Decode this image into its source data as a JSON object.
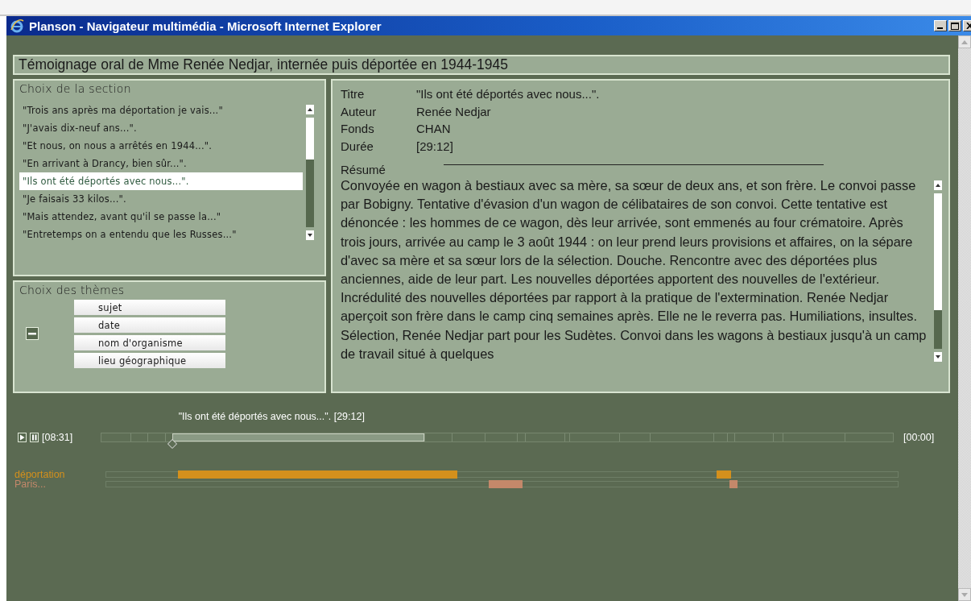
{
  "window": {
    "title": "Planson - Navigateur multimédia - Microsoft Internet Explorer"
  },
  "heading": "Témoignage oral de Mme Renée Nedjar, internée puis déportée en 1944-1945",
  "section_choice": {
    "title": "Choix de la section",
    "items": [
      {
        "label": "\"Trois ans après ma déportation je vais...\"",
        "selected": false
      },
      {
        "label": "\"J'avais dix-neuf ans...\".",
        "selected": false
      },
      {
        "label": "\"Et nous, on nous a arrêtés en 1944...\".",
        "selected": false
      },
      {
        "label": "\"En arrivant à Drancy, bien sûr...\".",
        "selected": false
      },
      {
        "label": "\"Ils ont été déportés avec nous...\".",
        "selected": true
      },
      {
        "label": "\"Je faisais 33 kilos...\".",
        "selected": false
      },
      {
        "label": "\"Mais attendez, avant qu'il se passe la...\"",
        "selected": false
      },
      {
        "label": "\"Entretemps on a entendu que les Russes...\"",
        "selected": false
      }
    ]
  },
  "theme_choice": {
    "title": "Choix des thèmes",
    "items": [
      "sujet",
      "date",
      "nom d'organisme",
      "lieu géographique"
    ]
  },
  "details": {
    "fields": [
      {
        "label": "Titre",
        "value": "\"Ils ont été déportés avec nous...\"."
      },
      {
        "label": "Auteur",
        "value": "Renée Nedjar"
      },
      {
        "label": "Fonds",
        "value": "CHAN"
      },
      {
        "label": "Durée",
        "value": "[29:12]"
      }
    ],
    "summary_label": "Résumé",
    "summary": "Convoyée en wagon à bestiaux avec sa mère, sa sœur de deux ans, et son frère. Le convoi passe par Bobigny. Tentative d'évasion d'un wagon de célibataires de son convoi. Cette tentative est dénoncée : les hommes de ce wagon, dès leur arrivée, sont emmenés au four crématoire. Après trois jours, arrivée au camp le 3 août 1944 : on leur prend leurs provisions et affaires, on la sépare d'avec sa mère et sa sœur lors de la sélection. Douche. Rencontre avec des déportées plus anciennes, aide de leur part. Les nouvelles déportées apportent des nouvelles de l'extérieur. Incrédulité des nouvelles déportées par rapport à la pratique de l'extermination. Renée Nedjar aperçoit son frère dans le camp cinq semaines après. Elle ne le reverra pas. Humiliations, insultes. Sélection, Renée Nedjar part pour les Sudètes. Convoi dans les wagons à bestiaux jusqu'à un camp de travail situé à quelques"
  },
  "player": {
    "current_label": "\"Ils ont été déportés avec nous...\". [29:12]",
    "elapsed": "[08:31]",
    "remaining": "[00:00]",
    "level": 0.09,
    "themes": [
      {
        "label": "déportation",
        "color": "#d4901c"
      },
      {
        "label": "Paris...",
        "color": "#c4886a"
      }
    ]
  }
}
